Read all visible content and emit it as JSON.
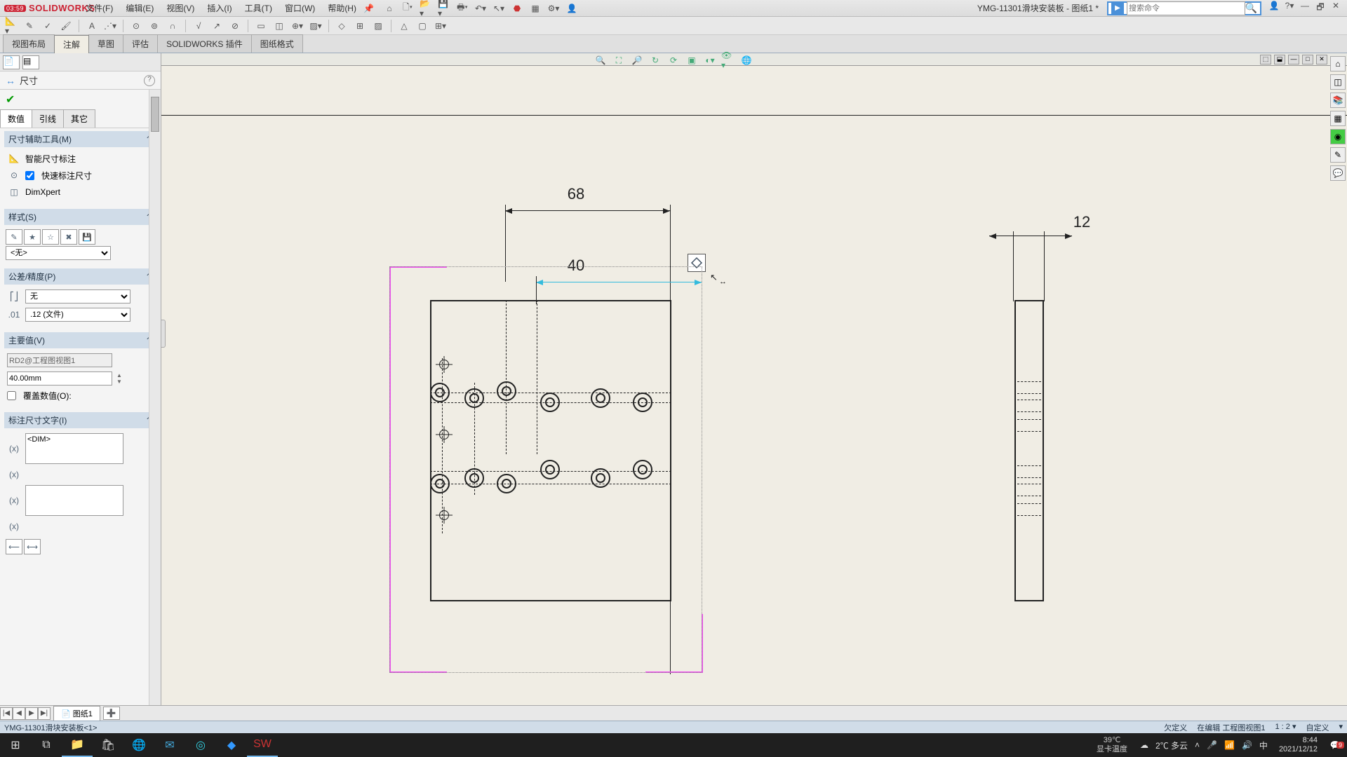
{
  "logo_text": "SOLIDWORKS",
  "rec_time": "03:59",
  "menu": {
    "file": "文件(F)",
    "edit": "编辑(E)",
    "view": "视图(V)",
    "insert": "插入(I)",
    "tools": "工具(T)",
    "window": "窗口(W)",
    "help": "帮助(H)"
  },
  "doc_title": "YMG-11301滑块安装板 - 图纸1 *",
  "search": {
    "placeholder": "搜索命令"
  },
  "tabs": {
    "layout": "视图布局",
    "annot": "注解",
    "sketch": "草图",
    "eval": "评估",
    "plugin": "SOLIDWORKS 插件",
    "format": "图纸格式"
  },
  "pm": {
    "title": "尺寸",
    "subtabs": {
      "value": "数值",
      "leader": "引线",
      "other": "其它"
    },
    "sec_tools": "尺寸辅助工具(M)",
    "smart_dim": "智能尺寸标注",
    "quick_dim": "快速标注尺寸",
    "dimxpert": "DimXpert",
    "sec_style": "样式(S)",
    "style_none": "<无>",
    "sec_tol": "公差/精度(P)",
    "tol_none": "无",
    "precision": ".12 (文件)",
    "sec_primary": "主要值(V)",
    "primary_name": "RD2@工程图视图1",
    "primary_value": "40.00mm",
    "override": "覆盖数值(O):",
    "sec_dimtext": "标注尺寸文字(I)",
    "dim_token": "<DIM>"
  },
  "drawing": {
    "dim68": "68",
    "dim40": "40",
    "dim12": "12"
  },
  "sheet_tab": "图纸1",
  "status": {
    "path": "YMG-11301滑块安装板<1>",
    "underdef": "欠定义",
    "editing": "在编辑 工程图视图1",
    "scale": "1 : 2",
    "custom": "自定义"
  },
  "taskbar": {
    "temp1": "39℃",
    "temp1_label": "显卡温度",
    "temp2": "2℃ 多云",
    "ime": "中",
    "time": "8:44",
    "date": "2021/12/12",
    "notif_count": "9"
  }
}
